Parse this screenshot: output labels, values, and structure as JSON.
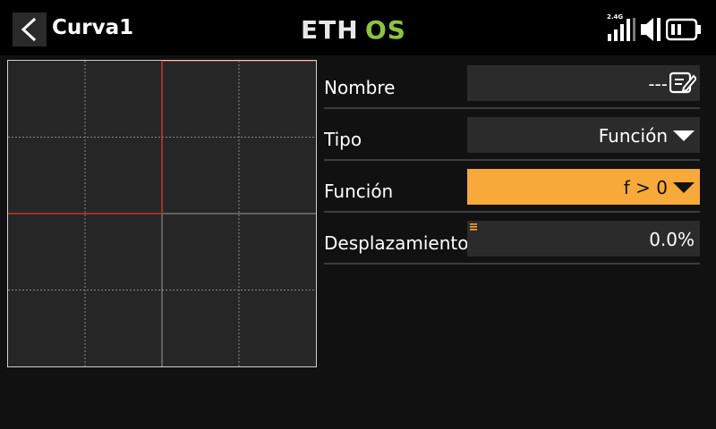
{
  "header": {
    "title": "Curva1",
    "logo_text": "ETHOS",
    "freq_label": "2.4G"
  },
  "form": {
    "rows": [
      {
        "label": "Nombre",
        "value": "---",
        "icon": "edit-icon"
      },
      {
        "label": "Tipo",
        "value": "Función",
        "icon": "chevron-down-icon"
      },
      {
        "label": "Función",
        "value": "f > 0",
        "icon": "chevron-down-icon",
        "active": true
      },
      {
        "label": "Desplazamiento",
        "value": "0.0%",
        "icon": "menu-icon"
      }
    ]
  },
  "chart_data": {
    "type": "line",
    "title": "",
    "xlabel": "",
    "ylabel": "",
    "xlim": [
      -100,
      100
    ],
    "ylim": [
      -100,
      100
    ],
    "grid": true,
    "series": [
      {
        "x": [
          -100,
          0,
          0,
          100
        ],
        "y": [
          0,
          0,
          100,
          100
        ]
      }
    ]
  },
  "colors": {
    "accent": "#f7a93a",
    "logo_green": "#8bc53f",
    "curve": "#c0392b"
  }
}
